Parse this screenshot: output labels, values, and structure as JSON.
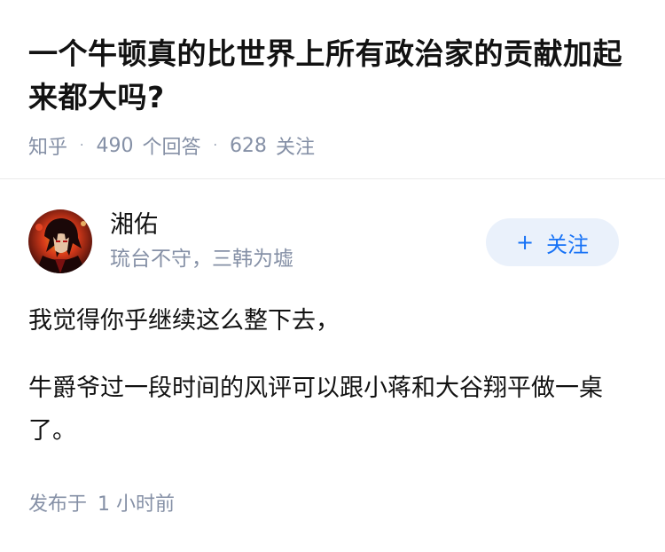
{
  "question": {
    "title": "一个牛顿真的比世界上所有政治家的贡献加起来都大吗?",
    "source": "知乎",
    "answers_count": "490",
    "answers_label": "个回答",
    "followers_count": "628",
    "followers_label": "关注"
  },
  "author": {
    "name": "湘佑",
    "bio": "琉台不守，三韩为墟",
    "follow_plus": "+",
    "follow_label": "关注",
    "avatar_icon": "avatar-icon"
  },
  "answer": {
    "paragraphs": [
      "我觉得你乎继续这么整下去，",
      "牛爵爷过一段时间的风评可以跟小蒋和大谷翔平做一桌了。"
    ]
  },
  "footer": {
    "published_label": "发布于",
    "published_time": "1 小时前"
  },
  "colors": {
    "accent": "#1772f6",
    "meta": "#8590a6",
    "follow_bg": "#eaf1fb"
  }
}
